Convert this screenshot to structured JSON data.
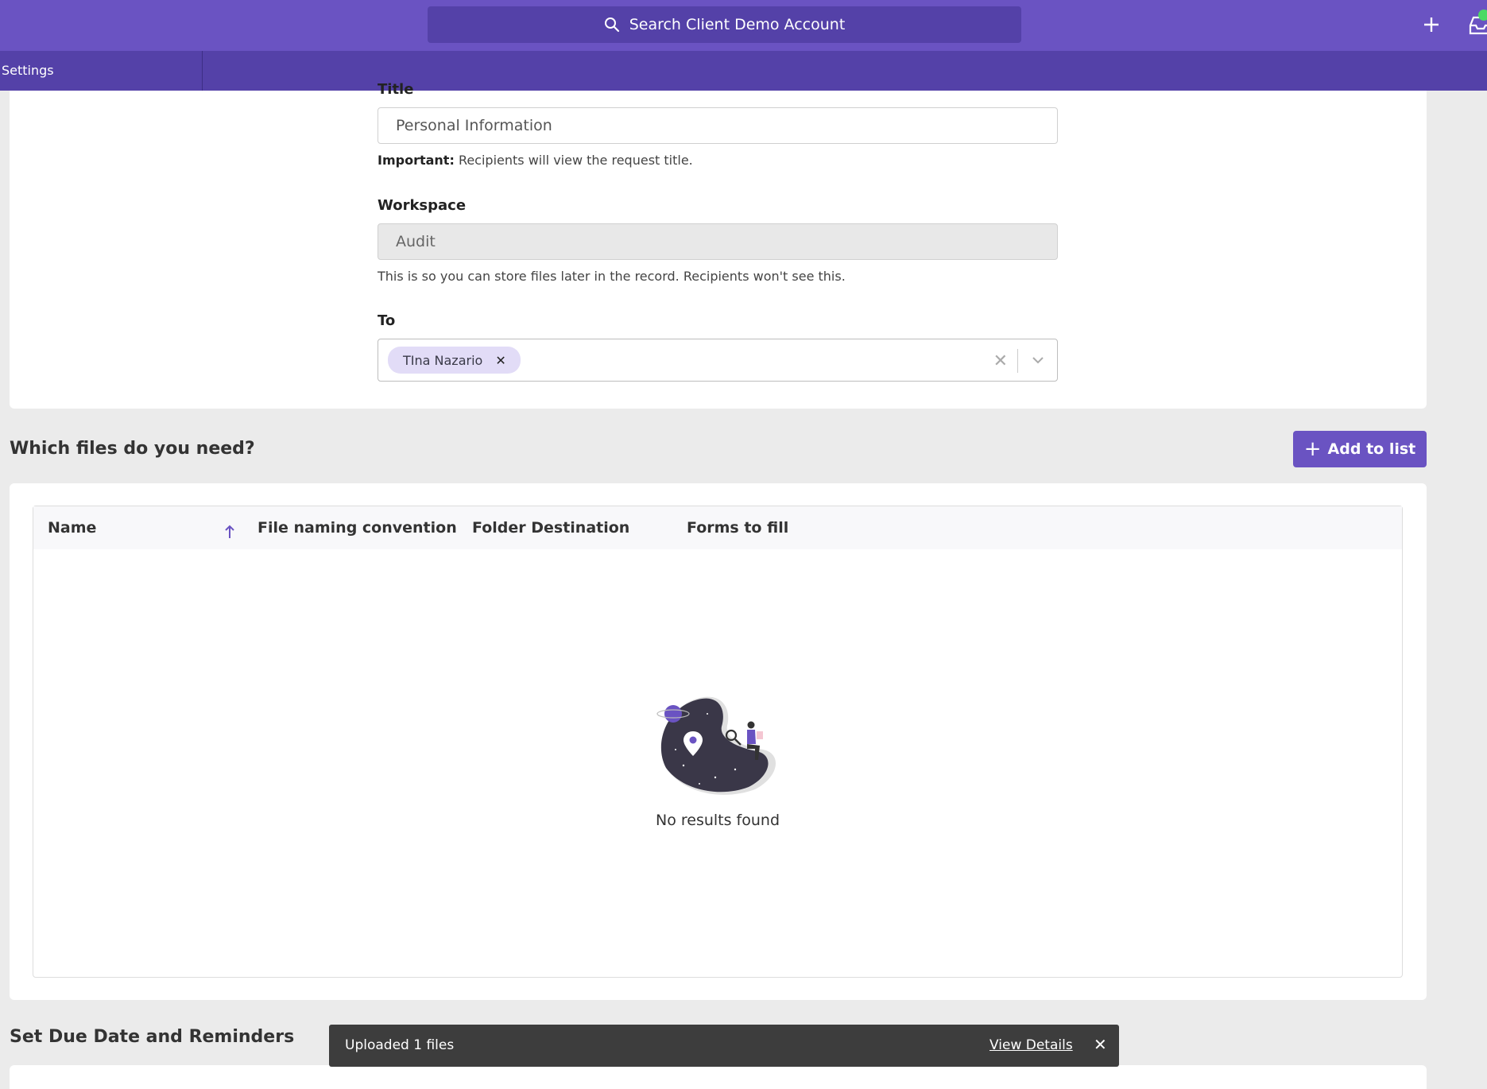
{
  "header": {
    "search_placeholder": "Search Client Demo Account"
  },
  "subnav": {
    "settings_label": "Settings"
  },
  "form": {
    "title_label": "Title",
    "title_value": "Personal Information",
    "title_help_bold": "Important:",
    "title_help": "Recipients will view the request title.",
    "workspace_label": "Workspace",
    "workspace_value": "Audit",
    "workspace_help": "This is so you can store files later in the record. Recipients won't see this.",
    "to_label": "To",
    "recipients": [
      "TIna Nazario"
    ]
  },
  "files": {
    "section_title": "Which files do you need?",
    "add_button": "Add to list",
    "columns": [
      "Name",
      "File naming convention",
      "Folder Destination",
      "Forms to fill"
    ],
    "empty_text": "No results found"
  },
  "due": {
    "section_title": "Set Due Date and Reminders"
  },
  "toast": {
    "message": "Uploaded 1 files",
    "link": "View Details"
  },
  "colors": {
    "brand": "#6a53c2",
    "brand_dark": "#5441a8",
    "chip_bg": "#e2dcf7",
    "toast_bg": "#3d3d3d"
  }
}
